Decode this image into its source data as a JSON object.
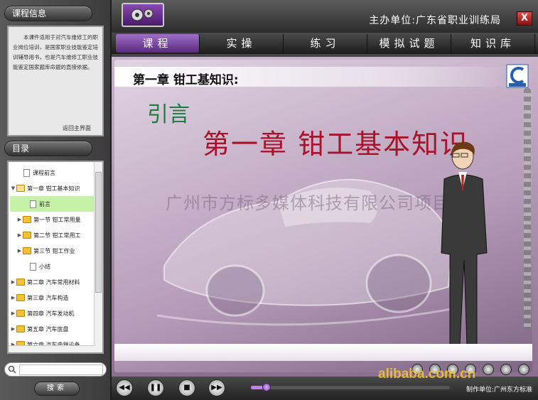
{
  "colors": {
    "accent": "#7a3ac0",
    "title_red": "#a8132a",
    "intro_green": "#1f7a3d"
  },
  "left": {
    "course_info_title": "课程信息",
    "course_info_text": "本课件适用于对汽车维修工的职业岗位培训，是国家职业技能鉴定培训辅导用书，也是汽车维修工职业技能鉴定国家题库命题的直接依据。",
    "back_link": "返回主界面",
    "toc_title": "目录",
    "toc": [
      {
        "label": "课程前言",
        "indent": 1,
        "icon": "doc-icon",
        "arrow": ""
      },
      {
        "label": "第一章 钳工基本知识",
        "indent": 0,
        "icon": "folder-open-icon",
        "arrow": "▼"
      },
      {
        "label": "前言",
        "indent": 2,
        "icon": "doc-icon",
        "arrow": "",
        "selected": true
      },
      {
        "label": "第一节 钳工常用量",
        "indent": 1,
        "icon": "folder-icon",
        "arrow": "▶"
      },
      {
        "label": "第二节 钳工常用工",
        "indent": 1,
        "icon": "folder-icon",
        "arrow": "▶"
      },
      {
        "label": "第三节 钳工作业",
        "indent": 1,
        "icon": "folder-icon",
        "arrow": "▶"
      },
      {
        "label": "小结",
        "indent": 2,
        "icon": "doc-icon",
        "arrow": ""
      },
      {
        "label": "第二章 汽车常用材料",
        "indent": 0,
        "icon": "folder-icon",
        "arrow": "▶"
      },
      {
        "label": "第三章 汽车构造",
        "indent": 0,
        "icon": "folder-icon",
        "arrow": "▶"
      },
      {
        "label": "第四章 汽车发动机",
        "indent": 0,
        "icon": "folder-icon",
        "arrow": "▶"
      },
      {
        "label": "第五章 汽车底盘",
        "indent": 0,
        "icon": "folder-icon",
        "arrow": "▶"
      },
      {
        "label": "第六章 汽车电器设备",
        "indent": 0,
        "icon": "folder-icon",
        "arrow": "▶"
      }
    ],
    "search_placeholder": "",
    "search_button": "搜索"
  },
  "top": {
    "org_label": "主办单位:广东省职业训练局",
    "close_label": "X"
  },
  "nav": {
    "tabs": [
      {
        "label": "课程",
        "active": true
      },
      {
        "label": "实操",
        "active": false
      },
      {
        "label": "练习",
        "active": false
      },
      {
        "label": "模拟试题",
        "active": false
      },
      {
        "label": "知识库",
        "active": false
      }
    ]
  },
  "content": {
    "chapter_label": "第一章  钳工基知识:",
    "intro": "引言",
    "big_title": "第一章  钳工基本知识",
    "watermark": "广州市方标多媒体科技有限公司项目部"
  },
  "player": {
    "progress": 0.08,
    "credits": "制作单位:广州东方标准",
    "site_mark": "alibaba.com.cn"
  }
}
